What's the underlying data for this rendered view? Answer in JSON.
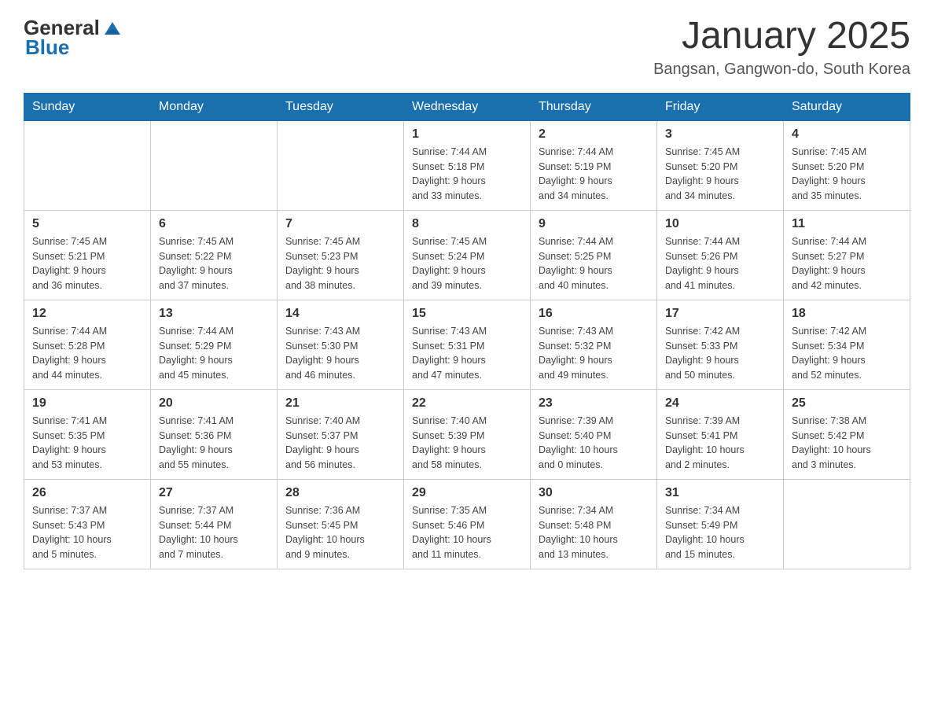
{
  "header": {
    "logo_general": "General",
    "logo_blue": "Blue",
    "title": "January 2025",
    "subtitle": "Bangsan, Gangwon-do, South Korea"
  },
  "weekdays": [
    "Sunday",
    "Monday",
    "Tuesday",
    "Wednesday",
    "Thursday",
    "Friday",
    "Saturday"
  ],
  "weeks": [
    [
      {
        "day": "",
        "info": ""
      },
      {
        "day": "",
        "info": ""
      },
      {
        "day": "",
        "info": ""
      },
      {
        "day": "1",
        "info": "Sunrise: 7:44 AM\nSunset: 5:18 PM\nDaylight: 9 hours\nand 33 minutes."
      },
      {
        "day": "2",
        "info": "Sunrise: 7:44 AM\nSunset: 5:19 PM\nDaylight: 9 hours\nand 34 minutes."
      },
      {
        "day": "3",
        "info": "Sunrise: 7:45 AM\nSunset: 5:20 PM\nDaylight: 9 hours\nand 34 minutes."
      },
      {
        "day": "4",
        "info": "Sunrise: 7:45 AM\nSunset: 5:20 PM\nDaylight: 9 hours\nand 35 minutes."
      }
    ],
    [
      {
        "day": "5",
        "info": "Sunrise: 7:45 AM\nSunset: 5:21 PM\nDaylight: 9 hours\nand 36 minutes."
      },
      {
        "day": "6",
        "info": "Sunrise: 7:45 AM\nSunset: 5:22 PM\nDaylight: 9 hours\nand 37 minutes."
      },
      {
        "day": "7",
        "info": "Sunrise: 7:45 AM\nSunset: 5:23 PM\nDaylight: 9 hours\nand 38 minutes."
      },
      {
        "day": "8",
        "info": "Sunrise: 7:45 AM\nSunset: 5:24 PM\nDaylight: 9 hours\nand 39 minutes."
      },
      {
        "day": "9",
        "info": "Sunrise: 7:44 AM\nSunset: 5:25 PM\nDaylight: 9 hours\nand 40 minutes."
      },
      {
        "day": "10",
        "info": "Sunrise: 7:44 AM\nSunset: 5:26 PM\nDaylight: 9 hours\nand 41 minutes."
      },
      {
        "day": "11",
        "info": "Sunrise: 7:44 AM\nSunset: 5:27 PM\nDaylight: 9 hours\nand 42 minutes."
      }
    ],
    [
      {
        "day": "12",
        "info": "Sunrise: 7:44 AM\nSunset: 5:28 PM\nDaylight: 9 hours\nand 44 minutes."
      },
      {
        "day": "13",
        "info": "Sunrise: 7:44 AM\nSunset: 5:29 PM\nDaylight: 9 hours\nand 45 minutes."
      },
      {
        "day": "14",
        "info": "Sunrise: 7:43 AM\nSunset: 5:30 PM\nDaylight: 9 hours\nand 46 minutes."
      },
      {
        "day": "15",
        "info": "Sunrise: 7:43 AM\nSunset: 5:31 PM\nDaylight: 9 hours\nand 47 minutes."
      },
      {
        "day": "16",
        "info": "Sunrise: 7:43 AM\nSunset: 5:32 PM\nDaylight: 9 hours\nand 49 minutes."
      },
      {
        "day": "17",
        "info": "Sunrise: 7:42 AM\nSunset: 5:33 PM\nDaylight: 9 hours\nand 50 minutes."
      },
      {
        "day": "18",
        "info": "Sunrise: 7:42 AM\nSunset: 5:34 PM\nDaylight: 9 hours\nand 52 minutes."
      }
    ],
    [
      {
        "day": "19",
        "info": "Sunrise: 7:41 AM\nSunset: 5:35 PM\nDaylight: 9 hours\nand 53 minutes."
      },
      {
        "day": "20",
        "info": "Sunrise: 7:41 AM\nSunset: 5:36 PM\nDaylight: 9 hours\nand 55 minutes."
      },
      {
        "day": "21",
        "info": "Sunrise: 7:40 AM\nSunset: 5:37 PM\nDaylight: 9 hours\nand 56 minutes."
      },
      {
        "day": "22",
        "info": "Sunrise: 7:40 AM\nSunset: 5:39 PM\nDaylight: 9 hours\nand 58 minutes."
      },
      {
        "day": "23",
        "info": "Sunrise: 7:39 AM\nSunset: 5:40 PM\nDaylight: 10 hours\nand 0 minutes."
      },
      {
        "day": "24",
        "info": "Sunrise: 7:39 AM\nSunset: 5:41 PM\nDaylight: 10 hours\nand 2 minutes."
      },
      {
        "day": "25",
        "info": "Sunrise: 7:38 AM\nSunset: 5:42 PM\nDaylight: 10 hours\nand 3 minutes."
      }
    ],
    [
      {
        "day": "26",
        "info": "Sunrise: 7:37 AM\nSunset: 5:43 PM\nDaylight: 10 hours\nand 5 minutes."
      },
      {
        "day": "27",
        "info": "Sunrise: 7:37 AM\nSunset: 5:44 PM\nDaylight: 10 hours\nand 7 minutes."
      },
      {
        "day": "28",
        "info": "Sunrise: 7:36 AM\nSunset: 5:45 PM\nDaylight: 10 hours\nand 9 minutes."
      },
      {
        "day": "29",
        "info": "Sunrise: 7:35 AM\nSunset: 5:46 PM\nDaylight: 10 hours\nand 11 minutes."
      },
      {
        "day": "30",
        "info": "Sunrise: 7:34 AM\nSunset: 5:48 PM\nDaylight: 10 hours\nand 13 minutes."
      },
      {
        "day": "31",
        "info": "Sunrise: 7:34 AM\nSunset: 5:49 PM\nDaylight: 10 hours\nand 15 minutes."
      },
      {
        "day": "",
        "info": ""
      }
    ]
  ]
}
